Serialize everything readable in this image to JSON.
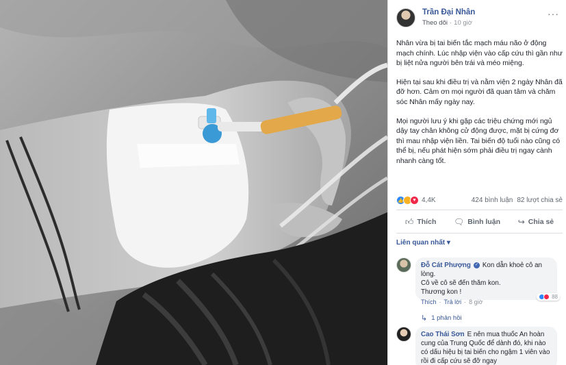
{
  "post": {
    "author": "Trần Đại Nhân",
    "follow_label": "Theo dõi",
    "separator": "·",
    "time": "10 giờ",
    "more_label": "···",
    "paragraphs": [
      "Nhân vừa bị tai biến tắc mạch máu não ở động mạch chính. Lúc nhập viện vào cấp cứu thì gần như bị liệt nửa người bên trái và méo miệng.",
      "Hiện tại sau khi điều trị và nằm viện 2 ngày Nhân đã đỡ hơn. Cảm ơn mọi người đã quan tâm và chăm sóc Nhân mấy ngày nay.",
      "Mọi người lưu ý khi gặp các triệu chứng mới ngủ dậy tay chân không cử động được, mặt bị cứng đơ thì mau nhập viện liền. Tai biến độ tuổi nào cũng có thể bị, nếu phát hiện sớm phải điều trị ngay cành nhanh càng tốt."
    ]
  },
  "stats": {
    "reaction_count": "4,4K",
    "comments": "424 bình luận",
    "shares": "82 lượt chia sẻ"
  },
  "actions": {
    "like": "Thích",
    "comment": "Bình luận",
    "share": "Chia sẻ"
  },
  "sort_label": "Liên quan nhất",
  "comments": [
    {
      "name": "Đỗ Cát Phượng",
      "text_line1": "Kon dẫn khoẻ cô an lòng.",
      "text_line2": "Cô về cô sẽ đến thăm kon.",
      "text_line3": "Thương kon !",
      "like": "Thích",
      "reply": "Trả lời",
      "time": "8 giờ",
      "reaction_count": "88",
      "replies_label": "1 phản hồi"
    },
    {
      "name": "Cao Thái Sơn",
      "text": "E nên mua thuốc An hoàn cung của Trung Quốc để dành đó, khi nào có dấu hiệu bị tai biến cho ngậm 1 viên vào rồi đi cấp cứu sẽ đỡ ngay"
    }
  ],
  "colors": {
    "link": "#385898",
    "meta": "#90949c",
    "like_blue": "#2d88ff",
    "sad_yellow": "#f7b125",
    "love_red": "#f0284a"
  }
}
